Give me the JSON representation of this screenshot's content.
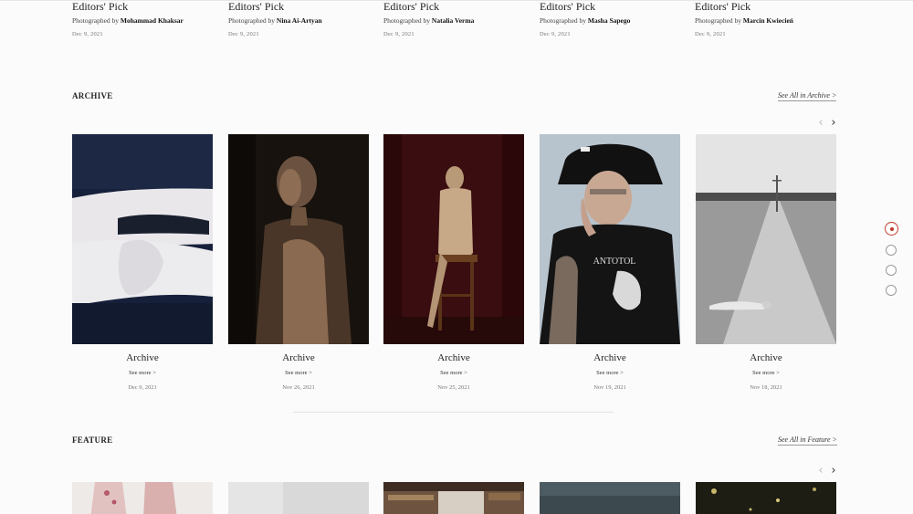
{
  "editors_pick": [
    {
      "title": "Editors' Pick",
      "by_prefix": "Photographed by",
      "photographer": "Mohammad Khaksar",
      "date": "Dec 9, 2021"
    },
    {
      "title": "Editors' Pick",
      "by_prefix": "Photographed by",
      "photographer": "Nina Ai-Artyan",
      "date": "Dec 9, 2021"
    },
    {
      "title": "Editors' Pick",
      "by_prefix": "Photographed by",
      "photographer": "Natalia Verma",
      "date": "Dec 9, 2021"
    },
    {
      "title": "Editors' Pick",
      "by_prefix": "Photographed by",
      "photographer": "Masha Sapego",
      "date": "Dec 9, 2021"
    },
    {
      "title": "Editors' Pick",
      "by_prefix": "Photographed by",
      "photographer": "Marcin Kwiecień",
      "date": "Dec 9, 2021"
    }
  ],
  "archive": {
    "title": "ARCHIVE",
    "see_all": "See All in Archive >",
    "prev_icon": "‹",
    "next_icon": "›",
    "cards": [
      {
        "label": "Archive",
        "more": "See more >",
        "date": "Dec 9, 2021"
      },
      {
        "label": "Archive",
        "more": "See more >",
        "date": "Nov 26, 2021"
      },
      {
        "label": "Archive",
        "more": "See more >",
        "date": "Nov 25, 2021"
      },
      {
        "label": "Archive",
        "more": "See more >",
        "date": "Nov 19, 2021"
      },
      {
        "label": "Archive",
        "more": "See more >",
        "date": "Nov 18, 2021"
      }
    ]
  },
  "feature": {
    "title": "FEATURE",
    "see_all": "See All in Feature >",
    "prev_icon": "‹",
    "next_icon": "›"
  },
  "colors": {
    "accent": "#c0392b",
    "background": "#fbfbfb"
  }
}
